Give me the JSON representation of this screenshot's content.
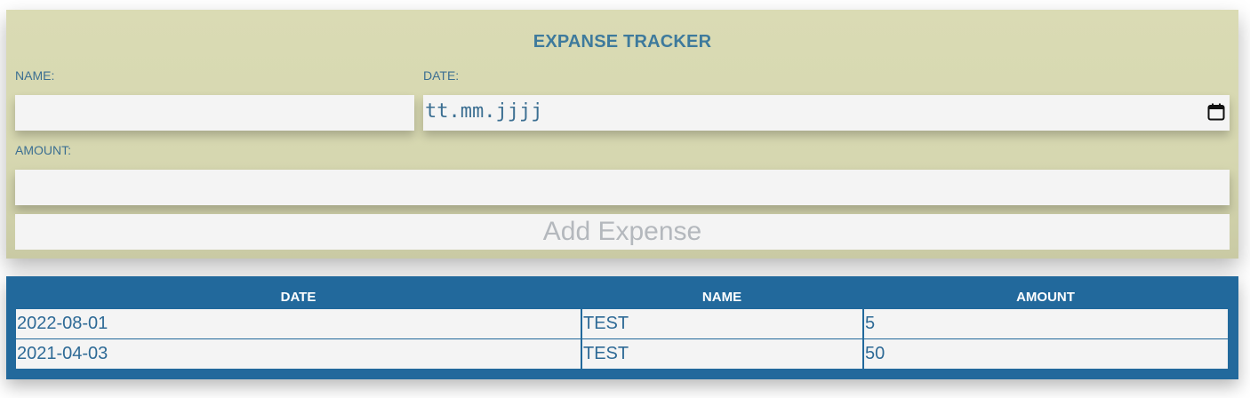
{
  "form": {
    "title": "EXPANSE TRACKER",
    "name_label": "NAME:",
    "name_value": "",
    "date_label": "DATE:",
    "date_placeholder": "tt.mm.jjjj",
    "amount_label": "AMOUNT:",
    "amount_value": "",
    "add_button_label": "Add Expense",
    "calendar_icon": "calendar-icon"
  },
  "table": {
    "headers": [
      "DATE",
      "NAME",
      "AMOUNT"
    ],
    "rows": [
      [
        "2022-08-01",
        "TEST",
        "5"
      ],
      [
        "2021-04-03",
        "TEST",
        "50"
      ]
    ]
  },
  "colors": {
    "form_background": "#d8d9b2",
    "title_text": "#3e7a9c",
    "label_text": "#3c6f92",
    "input_background": "#f4f4f4",
    "button_text": "#b4b8bd",
    "table_background": "#22699c",
    "table_header_text": "#ffffff",
    "table_cell_text": "#2e6a96"
  }
}
